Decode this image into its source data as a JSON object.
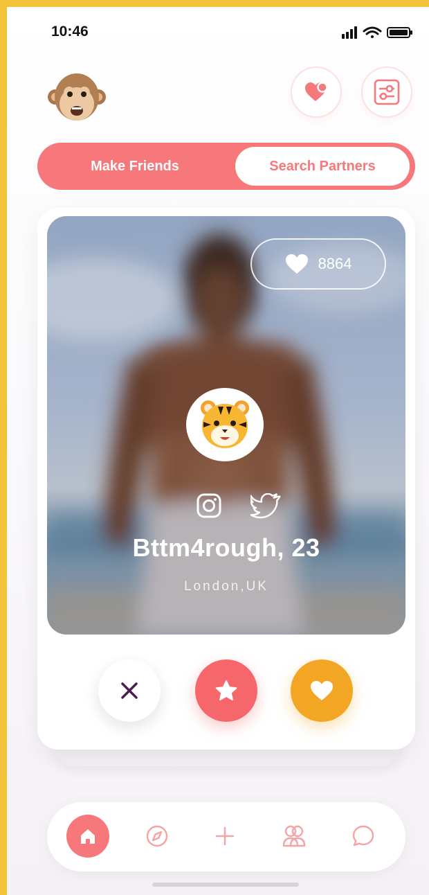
{
  "status_bar": {
    "time": "10:46"
  },
  "header": {
    "avatar_icon": "monkey-avatar-icon",
    "likes_button_icon": "heart-badge-icon",
    "filter_button_icon": "sliders-icon"
  },
  "segment": {
    "left_label": "Make Friends",
    "right_label": "Search Partners",
    "selected": "Search Partners"
  },
  "profile": {
    "likes_count": "8864",
    "emoji_icon": "tiger-face-icon",
    "name": "Bttm4rough, 23",
    "location": "London,UK",
    "socials": [
      "instagram-icon",
      "twitter-icon"
    ]
  },
  "actions": [
    "close-icon",
    "star-icon",
    "heart-icon"
  ],
  "bottom_nav": {
    "items": [
      "home-icon",
      "compass-icon",
      "plus-icon",
      "people-icon",
      "chat-icon"
    ],
    "active": "home-icon"
  },
  "colors": {
    "accent": "#f6787a",
    "like": "#f2a623",
    "pass_icon": "#4a1d4f",
    "frame": "#f2c33a"
  }
}
